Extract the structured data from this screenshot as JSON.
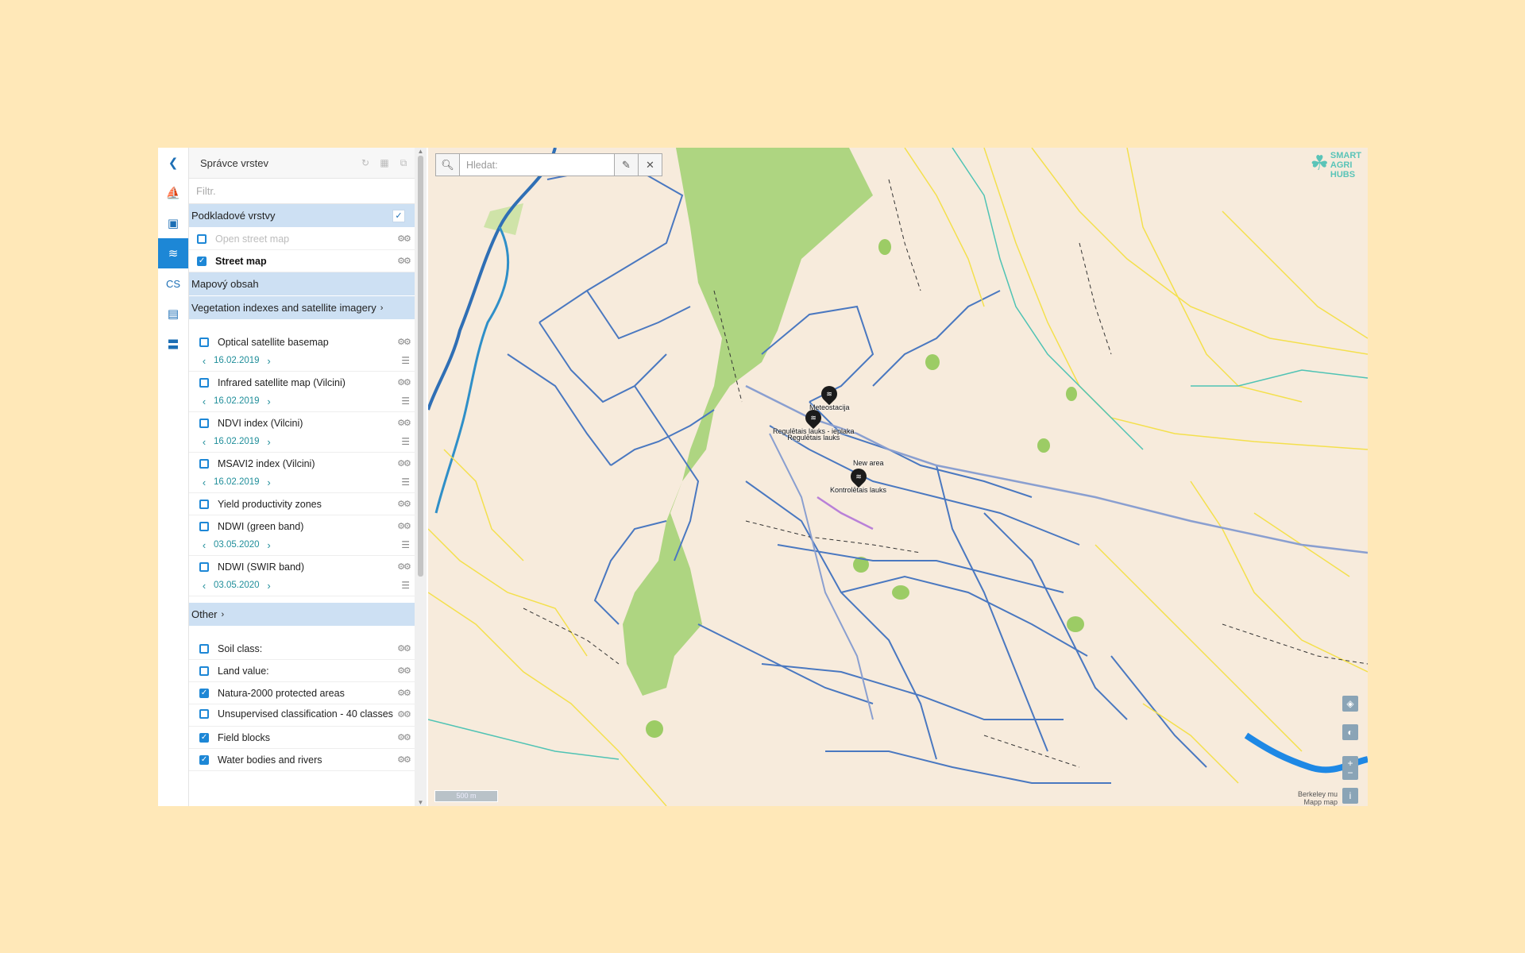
{
  "rail": {
    "items": [
      {
        "name": "collapse",
        "glyph": "❮"
      },
      {
        "name": "measure",
        "glyph": "⛵"
      },
      {
        "name": "save",
        "glyph": "▣"
      },
      {
        "name": "layers",
        "glyph": "≋"
      },
      {
        "name": "language",
        "glyph": "CS"
      },
      {
        "name": "legend",
        "glyph": "▤"
      },
      {
        "name": "menu",
        "glyph": "〓"
      }
    ]
  },
  "panel": {
    "title": "Správce vrstev",
    "filter_placeholder": "Filtr.",
    "base_group": {
      "title": "Podkladové vrstvy",
      "tick": "✓"
    },
    "base_layers": [
      {
        "label": "Open street map",
        "checked": false
      },
      {
        "label": "Street map",
        "checked": true
      }
    ],
    "content_group": {
      "title": "Mapový obsah"
    },
    "veg_group": {
      "title": "Vegetation indexes and satellite imagery",
      "chev": "›"
    },
    "veg_layers": [
      {
        "label": "Optical satellite basemap",
        "date": "16.02.2019"
      },
      {
        "label": "Infrared satellite map (Vilcini)",
        "date": "16.02.2019"
      },
      {
        "label": "NDVI index (Vilcini)",
        "date": "16.02.2019"
      },
      {
        "label": "MSAVI2 index (Vilcini)",
        "date": "16.02.2019"
      },
      {
        "label": "Yield productivity zones",
        "date": ""
      },
      {
        "label": "NDWI (green band)",
        "date": "03.05.2020"
      },
      {
        "label": "NDWI (SWIR band)",
        "date": "03.05.2020"
      }
    ],
    "other_group": {
      "title": "Other",
      "chev": "›"
    },
    "other_layers": [
      {
        "label": "Soil class:",
        "checked": false
      },
      {
        "label": "Land value:",
        "checked": false
      },
      {
        "label": "Natura-2000 protected areas",
        "checked": true
      },
      {
        "label": "Unsupervised classification - 40 classes",
        "checked": false
      },
      {
        "label": "Field blocks",
        "checked": true
      },
      {
        "label": "Water bodies and rivers",
        "checked": true
      }
    ]
  },
  "map": {
    "search_placeholder": "Hledat:",
    "logo": {
      "line1": "SMART",
      "line2": "AGRI",
      "line3": "HUBS"
    },
    "markers": [
      {
        "label": "Meteostacija"
      },
      {
        "label": "Regulētais lauks - ieplaka"
      },
      {
        "label": "Regulētais lauks"
      },
      {
        "label": "New area"
      },
      {
        "label": "Kontrolētais lauks"
      }
    ],
    "scale_label": "500 m",
    "attribution_line1": "Berkeley mu",
    "attribution_line2": "Mapp map"
  }
}
